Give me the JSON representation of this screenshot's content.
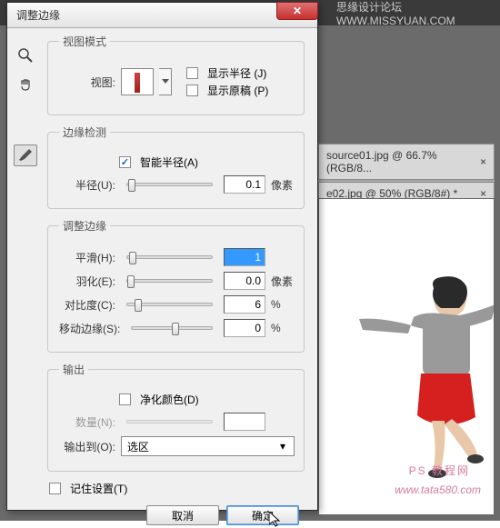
{
  "bg": {
    "header_text": "思缘设计论坛  WWW.MISSYUAN.COM",
    "tab1": "source01.jpg @ 66.7%(RGB/8...",
    "tab2": "e02.jpg @ 50% (RGB/8#) *",
    "wm1": "PS 教程网",
    "wm2": "www.tata580.com"
  },
  "dialog": {
    "title": "调整边缘",
    "view_mode": {
      "legend": "视图模式",
      "view_label": "视图:",
      "show_radius": "显示半径 (J)",
      "show_original": "显示原稿 (P)"
    },
    "edge_detect": {
      "legend": "边缘检测",
      "smart_radius": "智能半径(A)",
      "radius_label": "半径(U):",
      "radius_val": "0.1",
      "radius_unit": "像素"
    },
    "adjust": {
      "legend": "调整边缘",
      "smooth_label": "平滑(H):",
      "smooth_val": "1",
      "feather_label": "羽化(E):",
      "feather_val": "0.0",
      "feather_unit": "像素",
      "contrast_label": "对比度(C):",
      "contrast_val": "6",
      "contrast_unit": "%",
      "shift_label": "移动边缘(S):",
      "shift_val": "0",
      "shift_unit": "%"
    },
    "output": {
      "legend": "输出",
      "decon": "净化颜色(D)",
      "amount_label": "数量(N):",
      "amount_val": "",
      "out_label": "输出到(O):",
      "out_sel": "选区"
    },
    "remember": "记住设置(T)",
    "cancel": "取消",
    "ok": "确定"
  }
}
